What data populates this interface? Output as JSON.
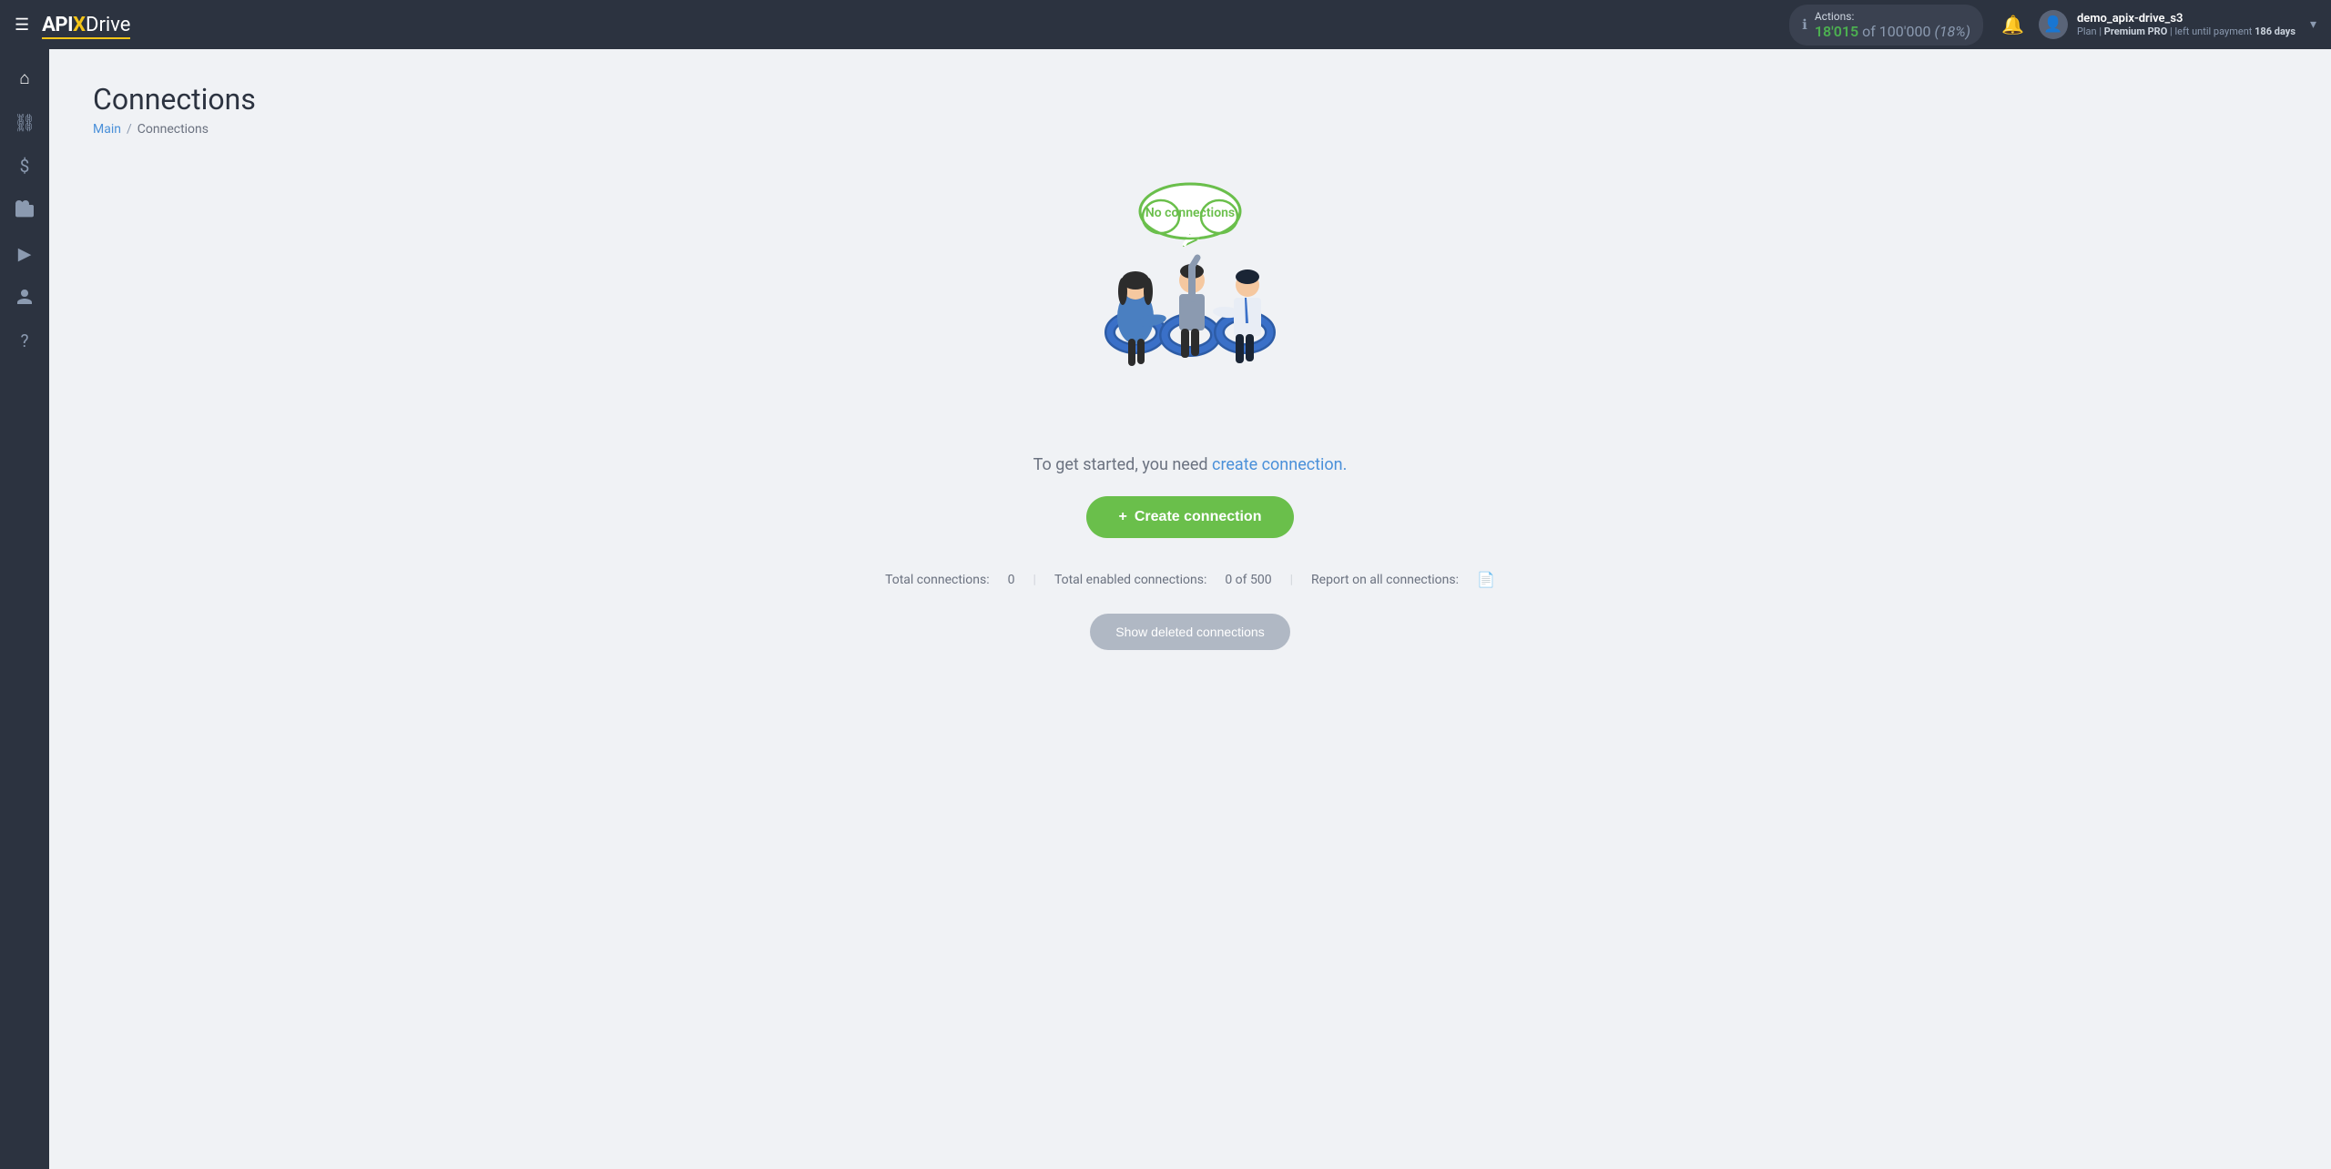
{
  "topnav": {
    "hamburger_label": "☰",
    "logo_api": "API",
    "logo_x": "X",
    "logo_drive": "Drive",
    "actions_label": "Actions:",
    "actions_used": "18'015",
    "actions_of": "of",
    "actions_total": "100'000",
    "actions_pct": "(18%)",
    "bell_icon": "🔔",
    "user_icon": "👤",
    "username": "demo_apix-drive_s3",
    "plan_prefix": "Plan |",
    "plan_name": "Premium PRO",
    "plan_suffix": "| left until payment",
    "plan_days": "186 days",
    "caret": "▾"
  },
  "sidebar": {
    "items": [
      {
        "icon": "⌂",
        "label": "home-icon"
      },
      {
        "icon": "⛓",
        "label": "connections-icon"
      },
      {
        "icon": "$",
        "label": "billing-icon"
      },
      {
        "icon": "💼",
        "label": "integrations-icon"
      },
      {
        "icon": "▶",
        "label": "video-icon"
      },
      {
        "icon": "👤",
        "label": "profile-icon"
      },
      {
        "icon": "?",
        "label": "help-icon"
      }
    ]
  },
  "page": {
    "title": "Connections",
    "breadcrumb_main": "Main",
    "breadcrumb_sep": "/",
    "breadcrumb_current": "Connections"
  },
  "illustration": {
    "cloud_text": "No connections"
  },
  "cta": {
    "text_prefix": "To get started, you need",
    "text_link": "create connection.",
    "button_plus": "+",
    "button_label": "Create connection"
  },
  "stats": {
    "total_connections_label": "Total connections:",
    "total_connections_value": "0",
    "total_enabled_label": "Total enabled connections:",
    "total_enabled_value": "0 of 500",
    "report_label": "Report on all connections:",
    "report_icon": "📄"
  },
  "show_deleted": {
    "label": "Show deleted connections"
  }
}
